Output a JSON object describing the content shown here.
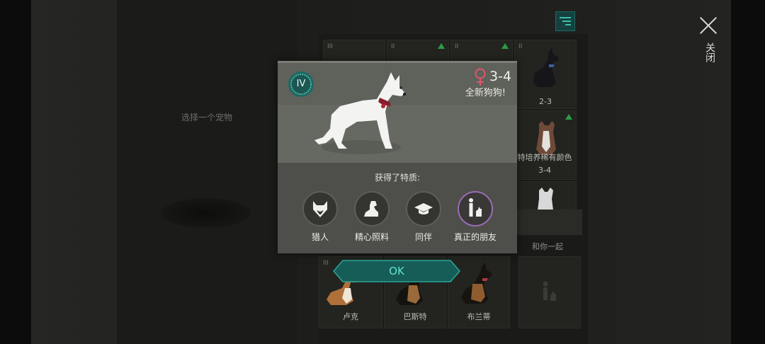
{
  "background": {
    "pick_label": "选择一个宠物",
    "close_label": "关闭",
    "grid": [
      {
        "id": "r0c0",
        "roman": "III",
        "arrow": false,
        "caption": ""
      },
      {
        "id": "r0c1",
        "roman": "II",
        "arrow": true,
        "caption": ""
      },
      {
        "id": "r0c2",
        "roman": "II",
        "arrow": true,
        "caption": ""
      },
      {
        "id": "r0c3",
        "roman": "II",
        "arrow": false,
        "caption": "2-3"
      },
      {
        "id": "r1c3",
        "roman": "",
        "arrow": true,
        "caption": "特培养稀有颜色3-4"
      },
      {
        "id": "r3c3_text",
        "caption": "和你一起"
      },
      {
        "id": "r4c0",
        "roman": "III",
        "arrow": false,
        "caption": "卢克"
      },
      {
        "id": "r4c1",
        "roman": "",
        "arrow": false,
        "caption": "巴斯特"
      },
      {
        "id": "r4c2",
        "roman": "",
        "arrow": false,
        "caption": "布兰蒂"
      }
    ]
  },
  "modal": {
    "tier": "IV",
    "gender_icon": "female-icon",
    "color_code": "3-4",
    "new_dog_text": "全新狗狗!",
    "traits_title": "获得了特质:",
    "traits": [
      {
        "label": "猎人",
        "icon": "fox-icon"
      },
      {
        "label": "精心照料",
        "icon": "sitting-dog-icon"
      },
      {
        "label": "同伴",
        "icon": "graduation-cap-icon"
      },
      {
        "label": "真正的朋友",
        "icon": "person-with-dog-icon"
      }
    ],
    "ok_label": "OK"
  },
  "colors": {
    "accent": "#3cc0b1",
    "special_trait": "#9a6db6",
    "female": "#e0566b",
    "up_arrow": "#2b9c47"
  }
}
